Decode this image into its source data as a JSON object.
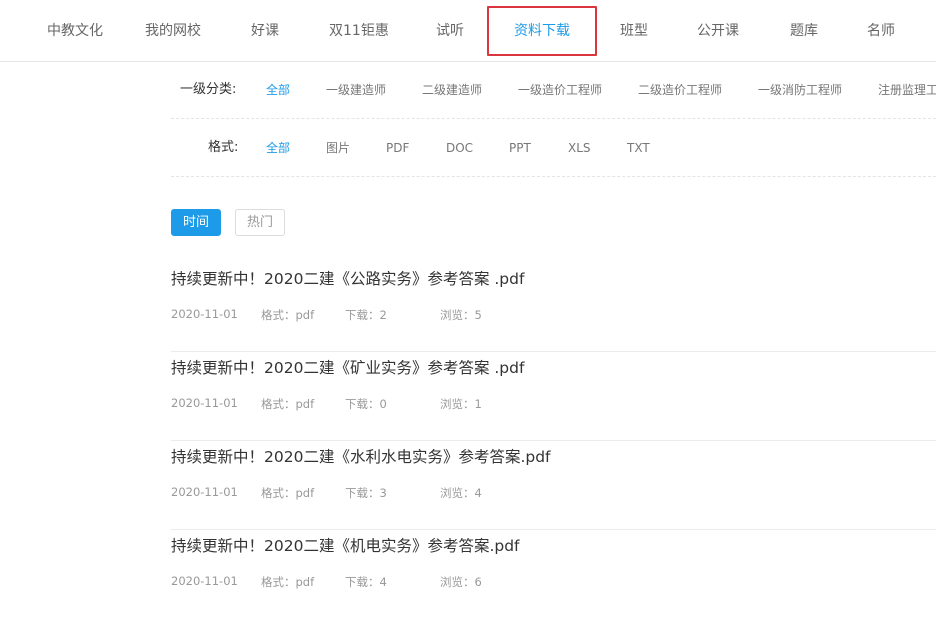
{
  "nav": {
    "items": [
      {
        "label": "中教文化"
      },
      {
        "label": "我的网校"
      },
      {
        "label": "好课"
      },
      {
        "label": "双11钜惠"
      },
      {
        "label": "试听"
      },
      {
        "label": "资料下载"
      },
      {
        "label": "班型"
      },
      {
        "label": "公开课"
      },
      {
        "label": "题库"
      },
      {
        "label": "名师"
      }
    ],
    "active_index": 5,
    "highlight_color": "#d9363e"
  },
  "filters": {
    "category": {
      "label": "一级分类:",
      "options": [
        "全部",
        "一级建造师",
        "二级建造师",
        "一级造价工程师",
        "二级造价工程师",
        "一级消防工程师",
        "注册监理工"
      ]
    },
    "format": {
      "label": "格式:",
      "options": [
        "全部",
        "图片",
        "PDF",
        "DOC",
        "PPT",
        "XLS",
        "TXT"
      ]
    }
  },
  "sort": {
    "time": "时间",
    "hot": "热门"
  },
  "items": [
    {
      "title": "持续更新中！2020二建《公路实务》参考答案 .pdf",
      "date": "2020-11-01",
      "format": "格式：pdf",
      "downloads": "下载：2",
      "views": "浏览：5"
    },
    {
      "title": "持续更新中！2020二建《矿业实务》参考答案 .pdf",
      "date": "2020-11-01",
      "format": "格式：pdf",
      "downloads": "下载：0",
      "views": "浏览：1"
    },
    {
      "title": "持续更新中！2020二建《水利水电实务》参考答案.pdf",
      "date": "2020-11-01",
      "format": "格式：pdf",
      "downloads": "下载：3",
      "views": "浏览：4"
    },
    {
      "title": "持续更新中！2020二建《机电实务》参考答案.pdf",
      "date": "2020-11-01",
      "format": "格式：pdf",
      "downloads": "下载：4",
      "views": "浏览：6"
    }
  ],
  "colors": {
    "accent": "#1e9be8",
    "text": "#333333",
    "muted": "#999999"
  }
}
